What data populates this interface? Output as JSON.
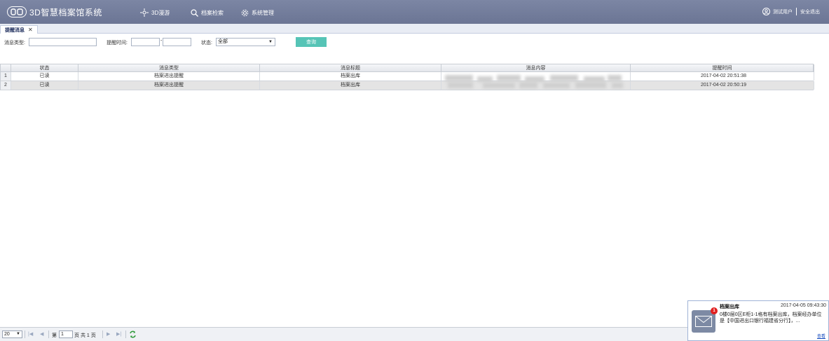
{
  "header": {
    "app_title": "3D智慧档案馆系统",
    "nav": [
      {
        "label": "3D漫游",
        "icon": "compass-icon"
      },
      {
        "label": "档案检索",
        "icon": "search-icon"
      },
      {
        "label": "系统管理",
        "icon": "gear-icon"
      }
    ],
    "user_name": "测试用户",
    "logout_label": "安全退出"
  },
  "tabs": [
    {
      "label": "提醒消息",
      "active": true
    }
  ],
  "filters": {
    "type_label": "消息类型:",
    "type_value": "",
    "time_label": "提醒时间:",
    "time_from": "",
    "time_sep": "-",
    "time_to": "",
    "status_label": "状态:",
    "status_value": "全部",
    "query_label": "查询"
  },
  "grid": {
    "columns": [
      "状态",
      "消息类型",
      "消息标题",
      "消息内容",
      "提醒时间"
    ],
    "rows": [
      {
        "rownum": "1",
        "status": "已读",
        "type": "档案进出提醒",
        "title": "档案出库",
        "content": "",
        "time": "2017-04-02 20:51:38"
      },
      {
        "rownum": "2",
        "status": "已读",
        "type": "档案进出提醒",
        "title": "档案出库",
        "content": "",
        "time": "2017-04-02 20:50:19"
      }
    ]
  },
  "pager": {
    "page_size": "20",
    "page_label": "第",
    "page_value": "1",
    "total_text": "页 共 1 页"
  },
  "notification": {
    "badge": "1",
    "title": "档案出库",
    "time": "2017-04-05 09:43:30",
    "body": "0楼0层0区E柜1-1格有档案出库，档案经办单位是【中国进出口银行福建省分行】，...",
    "more_label": "查看"
  },
  "colors": {
    "header_bg": "#737d9c",
    "query_button": "#56c4b6",
    "badge": "#e02020",
    "selected_row": "#e4e4e4"
  }
}
